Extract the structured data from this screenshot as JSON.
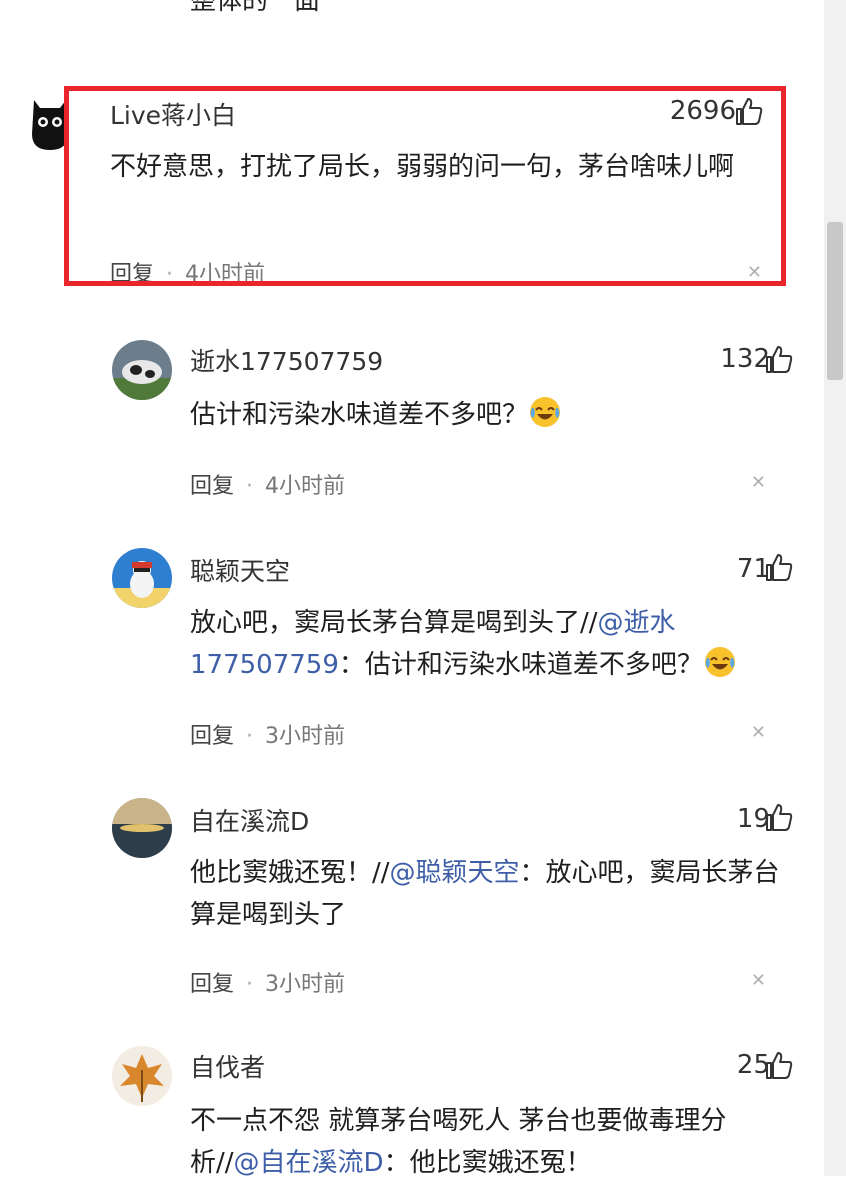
{
  "top_fragment": "整体的一面",
  "comments": [
    {
      "user": "Live蒋小白",
      "likes": "2696",
      "text": "不好意思，打扰了局长，弱弱的问一句，茅台啥味儿啊",
      "reply_label": "回复",
      "time": "4小时前",
      "highlighted": true
    },
    {
      "user": "逝水177507759",
      "likes": "132",
      "text": "估计和污染水味道差不多吧？",
      "emoji": "laugh-cry",
      "reply_label": "回复",
      "time": "4小时前"
    },
    {
      "user": "聪颖天空",
      "likes": "71",
      "text_before": "放心吧，窦局长茅台算是喝到头了//",
      "mention": "@逝水177507759",
      "text_after": "：估计和污染水味道差不多吧？",
      "emoji": "laugh-cry",
      "reply_label": "回复",
      "time": "3小时前"
    },
    {
      "user": "自在溪流D",
      "likes": "19",
      "text_before": "他比窦娥还冤！//",
      "mention": "@聪颖天空",
      "text_after": "：放心吧，窦局长茅台算是喝到头了",
      "reply_label": "回复",
      "time": "3小时前"
    },
    {
      "user": "自伐者",
      "likes": "25",
      "text_before": "不一点不怨 就算茅台喝死人 茅台也要做毒理分析//",
      "mention": "@自在溪流D",
      "text_after": "：他比窦娥还冤！"
    }
  ],
  "colors": {
    "highlight_border": "#e8262c",
    "mention": "#3e5fa8"
  },
  "icons": [
    "thumbs-up-icon",
    "close-icon",
    "laugh-cry-emoji"
  ]
}
